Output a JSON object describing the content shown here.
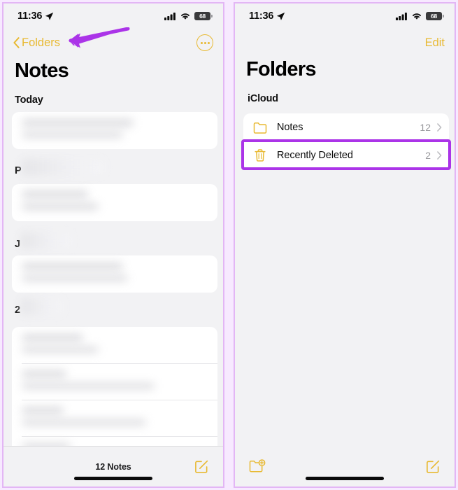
{
  "annotation": {
    "arrow_color": "#ab34e8",
    "highlight_color": "#ab34e8",
    "arrow_target": "back-to-folders-button",
    "highlight_target": "recently-deleted-row"
  },
  "theme": {
    "accent": "#e8b931",
    "panel_bg": "#f2f2f4",
    "card_bg": "#ffffff",
    "border": "#e3b6f5"
  },
  "left_panel": {
    "status": {
      "time": "11:36",
      "location_icon": "location-arrow-icon",
      "cellular_icon": "cellular-bars-icon",
      "wifi_icon": "wifi-icon",
      "battery_level": "68"
    },
    "nav": {
      "back_label": "Folders",
      "back_icon": "chevron-left-icon",
      "more_icon": "more-ellipsis-icon"
    },
    "title": "Notes",
    "sections": [
      {
        "label": "Today",
        "redacted": false
      },
      {
        "label": "P",
        "redacted": true
      },
      {
        "label": "J",
        "redacted": true
      },
      {
        "label": "2",
        "redacted": true
      }
    ],
    "toolbar": {
      "count_label": "12 Notes",
      "compose_icon": "compose-icon"
    }
  },
  "right_panel": {
    "status": {
      "time": "11:36",
      "location_icon": "location-arrow-icon",
      "cellular_icon": "cellular-bars-icon",
      "wifi_icon": "wifi-icon",
      "battery_level": "68"
    },
    "nav": {
      "edit_label": "Edit"
    },
    "title": "Folders",
    "list_label": "iCloud",
    "folders": [
      {
        "name": "Notes",
        "count": "12",
        "icon": "folder-icon",
        "chevron": "chevron-right-icon",
        "highlighted": false
      },
      {
        "name": "Recently Deleted",
        "count": "2",
        "icon": "trash-icon",
        "chevron": "chevron-right-icon",
        "highlighted": true
      }
    ],
    "toolbar": {
      "new_folder_icon": "new-folder-icon",
      "compose_icon": "compose-icon"
    }
  }
}
